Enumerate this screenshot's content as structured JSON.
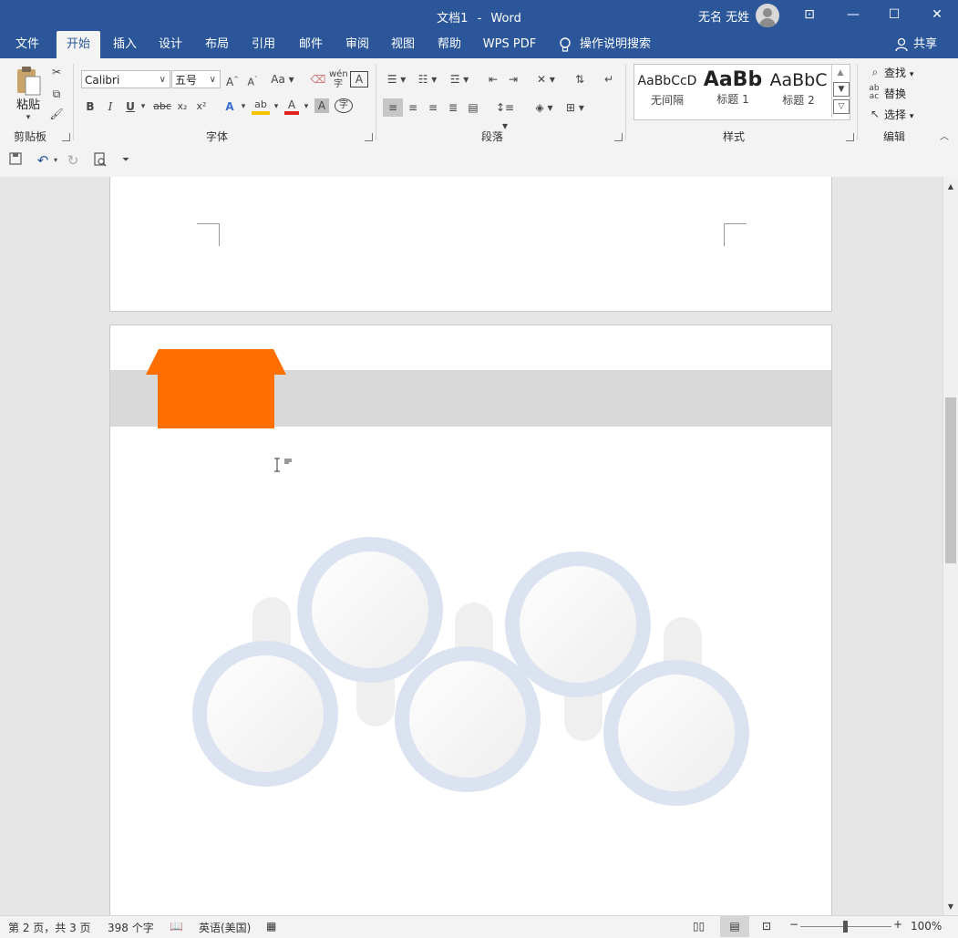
{
  "window": {
    "doc_title": "文档1",
    "app_name": "Word",
    "title_separator": "-",
    "user_name": "无名 无姓",
    "controls": {
      "ribbon_display": "⊡",
      "minimize": "—",
      "maximize": "☐",
      "close": "✕"
    }
  },
  "tabs": [
    "文件",
    "开始",
    "插入",
    "设计",
    "布局",
    "引用",
    "邮件",
    "审阅",
    "视图",
    "帮助",
    "WPS PDF"
  ],
  "active_tab": "开始",
  "tell_me": "操作说明搜索",
  "share": "共享",
  "ribbon": {
    "clipboard": {
      "paste_label": "粘贴",
      "group_label": "剪贴板"
    },
    "font": {
      "font_name": "Calibri",
      "font_size": "五号",
      "group_label": "字体",
      "change_case": "Aa",
      "bold": "B",
      "italic": "I",
      "underline": "U",
      "strike": "abc",
      "sub": "x₂",
      "sup": "x²"
    },
    "paragraph": {
      "group_label": "段落"
    },
    "styles": {
      "group_label": "样式",
      "items": [
        {
          "sample": "AaBbCcD",
          "name": "无间隔"
        },
        {
          "sample": "AaBb",
          "name": "标题 1"
        },
        {
          "sample": "AaBbC",
          "name": "标题 2"
        }
      ]
    },
    "editing": {
      "find": "查找",
      "replace": "替换",
      "select": "选择",
      "group_label": "编辑"
    }
  },
  "colors": {
    "brand": "#2b579a",
    "ribbon_bg": "#f3f3f3",
    "orange_shape": "#ff6f00",
    "gray_band": "#d9d9d9",
    "circle_ring": "#dbe3f1",
    "pillar": "#efefef"
  },
  "status": {
    "page_info": "第 2 页，共 3 页",
    "word_count": "398 个字",
    "language": "英语(美国)",
    "zoom": "100%"
  }
}
